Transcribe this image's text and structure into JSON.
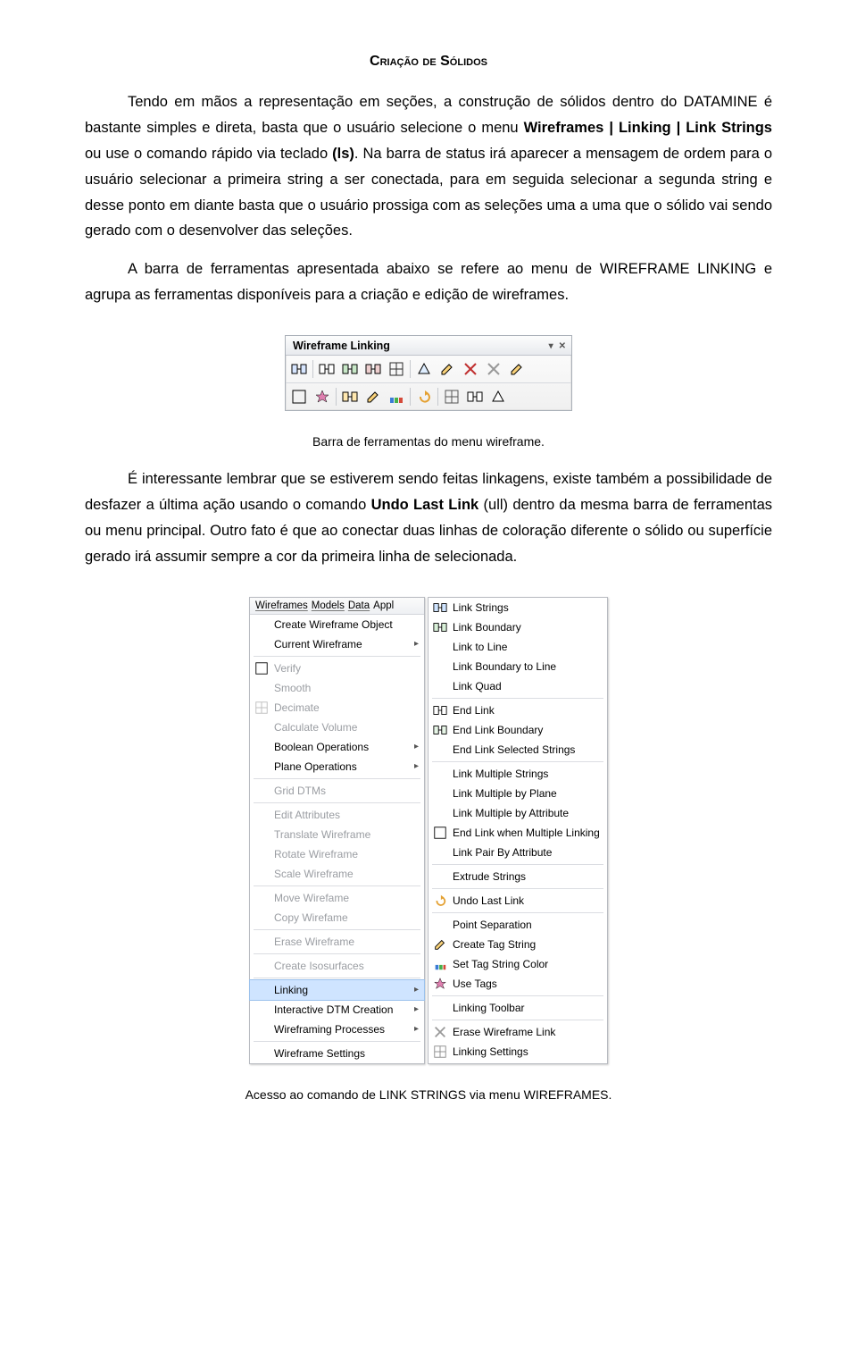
{
  "heading": "Criação de Sólidos",
  "para1_pre": "Tendo em mãos a representação em seções, a construção de sólidos dentro do DATAMINE é bastante simples e direta, basta que o usuário selecione o menu ",
  "b1": "Wireframes | Linking | Link Strings",
  "para1_mid": " ou use o comando rápido via teclado ",
  "b2": "(ls)",
  "para1_post": ". Na barra de status irá aparecer a mensagem de ordem para o usuário selecionar a primeira string a ser conectada, para em seguida selecionar a segunda string e desse ponto em diante basta que o usuário prossiga com as seleções uma a uma que o sólido vai sendo gerado com o desenvolver das seleções.",
  "para2": "A barra de ferramentas apresentada abaixo se refere ao menu de WIREFRAME LINKING e agrupa as ferramentas disponíveis para a criação e edição de wireframes.",
  "toolbar": {
    "title": "Wireframe Linking",
    "close": "✕",
    "dropdown": "▾"
  },
  "caption1": "Barra de ferramentas do menu wireframe.",
  "para3_pre": "É interessante lembrar que se estiverem sendo feitas linkagens, existe também a possibilidade de desfazer a última ação usando o comando ",
  "b3": "Undo Last Link",
  "para3_post": " (ull) dentro da mesma barra de ferramentas ou menu principal. Outro fato é que ao conectar duas linhas de coloração diferente o sólido ou superfície gerado irá assumir sempre a cor da primeira linha de selecionada.",
  "menubar": {
    "wireframes": "Wireframes",
    "models": "Models",
    "data": "Data",
    "appl": "Appl"
  },
  "menu_left": [
    {
      "label": "Create Wireframe Object",
      "enabled": true
    },
    {
      "label": "Current Wireframe",
      "enabled": true,
      "submenu": true
    },
    {
      "sep": true
    },
    {
      "label": "Verify",
      "enabled": false
    },
    {
      "label": "Smooth",
      "enabled": false
    },
    {
      "label": "Decimate",
      "enabled": false
    },
    {
      "label": "Calculate Volume",
      "enabled": false
    },
    {
      "label": "Boolean Operations",
      "enabled": true,
      "submenu": true
    },
    {
      "label": "Plane Operations",
      "enabled": true,
      "submenu": true
    },
    {
      "sep": true
    },
    {
      "label": "Grid DTMs",
      "enabled": false
    },
    {
      "sep": true
    },
    {
      "label": "Edit Attributes",
      "enabled": false
    },
    {
      "label": "Translate Wireframe",
      "enabled": false
    },
    {
      "label": "Rotate Wireframe",
      "enabled": false
    },
    {
      "label": "Scale Wireframe",
      "enabled": false
    },
    {
      "sep": true
    },
    {
      "label": "Move Wirefame",
      "enabled": false
    },
    {
      "label": "Copy Wirefame",
      "enabled": false
    },
    {
      "sep": true
    },
    {
      "label": "Erase Wireframe",
      "enabled": false
    },
    {
      "sep": true
    },
    {
      "label": "Create Isosurfaces",
      "enabled": false
    },
    {
      "sep": true
    },
    {
      "label": "Linking",
      "enabled": true,
      "submenu": true,
      "selected": true
    },
    {
      "label": "Interactive DTM Creation",
      "enabled": true,
      "submenu": true
    },
    {
      "label": "Wireframing Processes",
      "enabled": true,
      "submenu": true
    },
    {
      "sep": true
    },
    {
      "label": "Wireframe Settings",
      "enabled": true
    }
  ],
  "menu_right": [
    {
      "label": "Link Strings"
    },
    {
      "label": "Link Boundary"
    },
    {
      "label": "Link to Line"
    },
    {
      "label": "Link Boundary to Line"
    },
    {
      "label": "Link Quad"
    },
    {
      "sep": true
    },
    {
      "label": "End Link"
    },
    {
      "label": "End Link Boundary"
    },
    {
      "label": "End Link Selected Strings"
    },
    {
      "sep": true
    },
    {
      "label": "Link Multiple Strings"
    },
    {
      "label": "Link Multiple by Plane"
    },
    {
      "label": "Link Multiple by Attribute"
    },
    {
      "label": "End Link when Multiple Linking"
    },
    {
      "label": "Link Pair By Attribute"
    },
    {
      "sep": true
    },
    {
      "label": "Extrude Strings"
    },
    {
      "sep": true
    },
    {
      "label": "Undo Last Link"
    },
    {
      "sep": true
    },
    {
      "label": "Point Separation"
    },
    {
      "label": "Create Tag String"
    },
    {
      "label": "Set Tag String Color"
    },
    {
      "label": "Use Tags"
    },
    {
      "sep": true
    },
    {
      "label": "Linking Toolbar"
    },
    {
      "sep": true
    },
    {
      "label": "Erase Wireframe Link"
    },
    {
      "label": "Linking Settings"
    }
  ],
  "caption2": "Acesso ao comando de LINK STRINGS via menu WIREFRAMES."
}
